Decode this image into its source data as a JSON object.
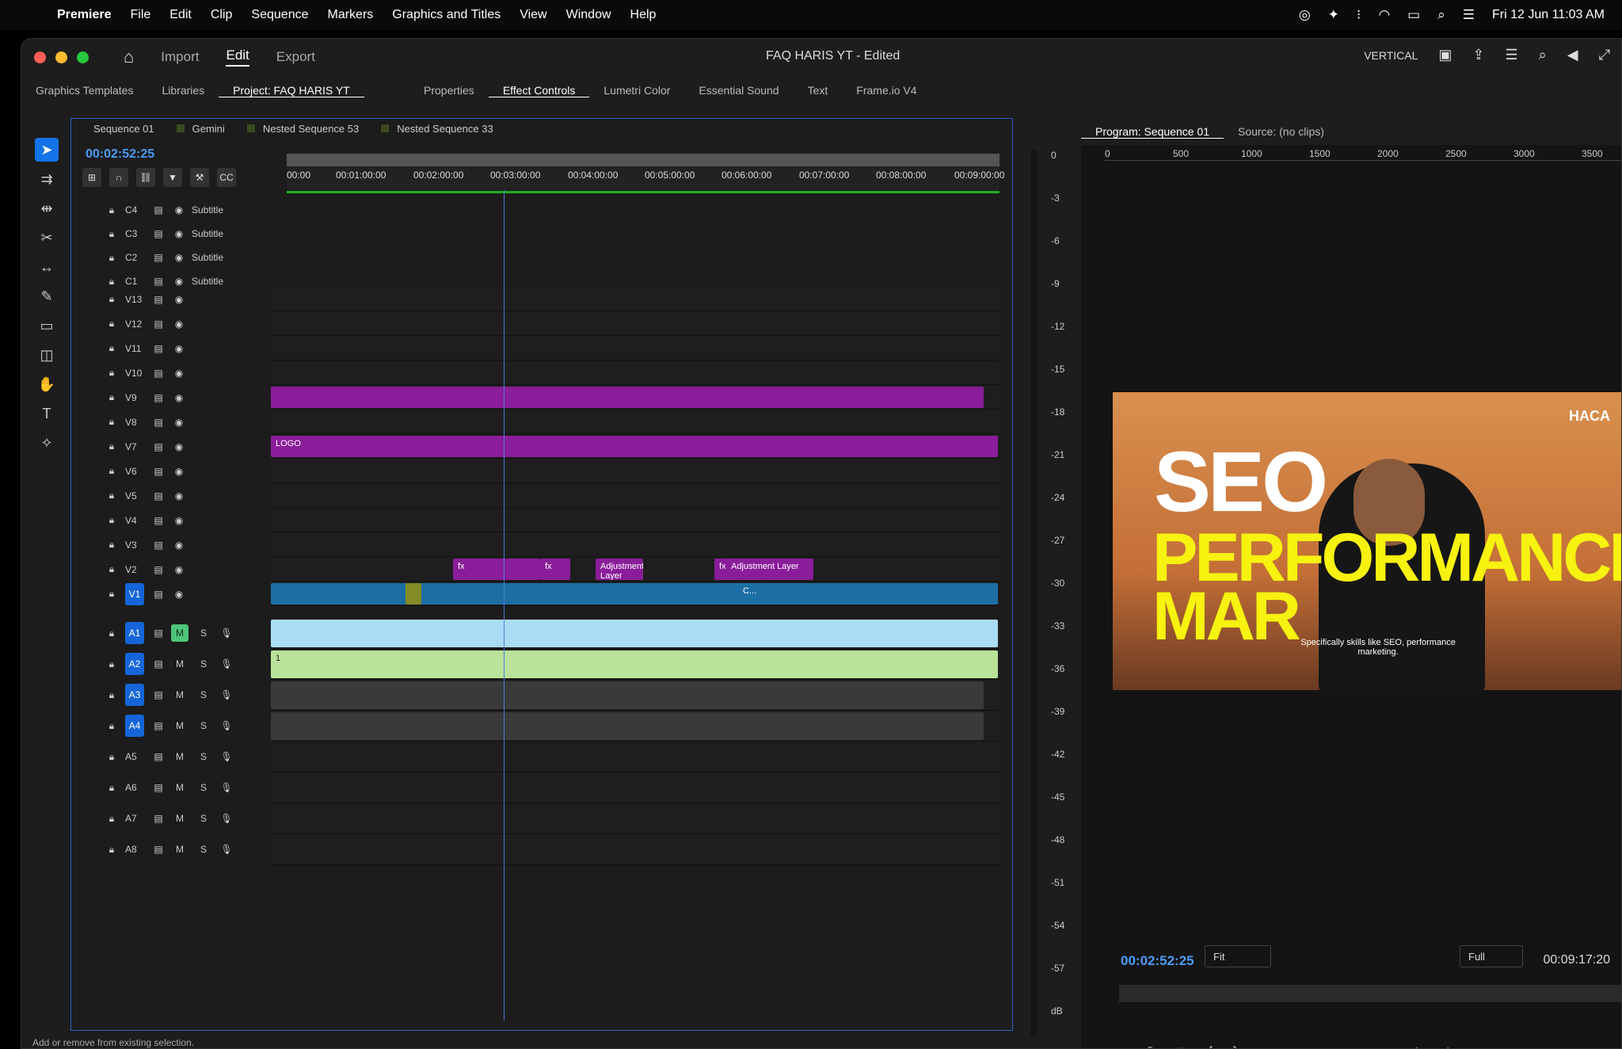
{
  "menubar": {
    "apple": "",
    "app": "Premiere",
    "items": [
      "File",
      "Edit",
      "Clip",
      "Sequence",
      "Markers",
      "Graphics and Titles",
      "View",
      "Window",
      "Help"
    ],
    "clock": "Fri 12 Jun  11:03 AM"
  },
  "window": {
    "workspaces": [
      "Import",
      "Edit",
      "Export"
    ],
    "active_workspace": "Edit",
    "title": "FAQ HARIS YT - Edited",
    "vertical_label": "VERTICAL"
  },
  "left_tabs": [
    "Graphics Templates",
    "Libraries",
    "Project: FAQ HARIS YT"
  ],
  "mid_tabs": [
    "Properties",
    "Effect Controls",
    "Lumetri Color",
    "Essential Sound",
    "Text",
    "Frame.io V4"
  ],
  "right_tabs": [
    "Program: Sequence 01",
    "Source: (no clips)"
  ],
  "timeline": {
    "tabs": [
      "Sequence 01",
      "Gemini",
      "Nested Sequence 53",
      "Nested Sequence 33"
    ],
    "timecode": "00:02:52:25",
    "ruler": [
      "00:00",
      "00:01:00:00",
      "00:02:00:00",
      "00:03:00:00",
      "00:04:00:00",
      "00:05:00:00",
      "00:06:00:00",
      "00:07:00:00",
      "00:08:00:00",
      "00:09:00:00"
    ],
    "caption_tracks": [
      {
        "id": "C4",
        "name": "Subtitle"
      },
      {
        "id": "C3",
        "name": "Subtitle"
      },
      {
        "id": "C2",
        "name": "Subtitle"
      },
      {
        "id": "C1",
        "name": "Subtitle"
      }
    ],
    "video_tracks": [
      "V13",
      "V12",
      "V11",
      "V10",
      "V9",
      "V8",
      "V7",
      "V6",
      "V5",
      "V4",
      "V3",
      "V2",
      "V1"
    ],
    "audio_tracks": [
      "A1",
      "A2",
      "A3",
      "A4",
      "A5",
      "A6",
      "A7",
      "A8"
    ],
    "clip_labels": {
      "logo": "LOGO",
      "adj1": "Adjustment Layer",
      "adj2": "Adjustment Layer",
      "c": "C...",
      "fx": "fx",
      "num": "1"
    }
  },
  "meter": {
    "labels": [
      "0",
      "-3",
      "-6",
      "-9",
      "-12",
      "-15",
      "-18",
      "-21",
      "-24",
      "-27",
      "-30",
      "-33",
      "-36",
      "-39",
      "-42",
      "-45",
      "-48",
      "-51",
      "-54",
      "-57",
      "dB"
    ]
  },
  "program": {
    "ruler": [
      "0",
      "500",
      "1000",
      "1500",
      "2000",
      "2500",
      "3000",
      "3500"
    ],
    "overlay": {
      "brand": "HACA",
      "seo": "SEO",
      "perf": "PERFORMANCE",
      "mark": "MAR",
      "caption": "Specifically skills like SEO, performance marketing."
    },
    "timecode": "00:02:52:25",
    "fit": "Fit",
    "quality": "Full",
    "duration": "00:09:17:20"
  },
  "status": "Add or remove from existing selection."
}
